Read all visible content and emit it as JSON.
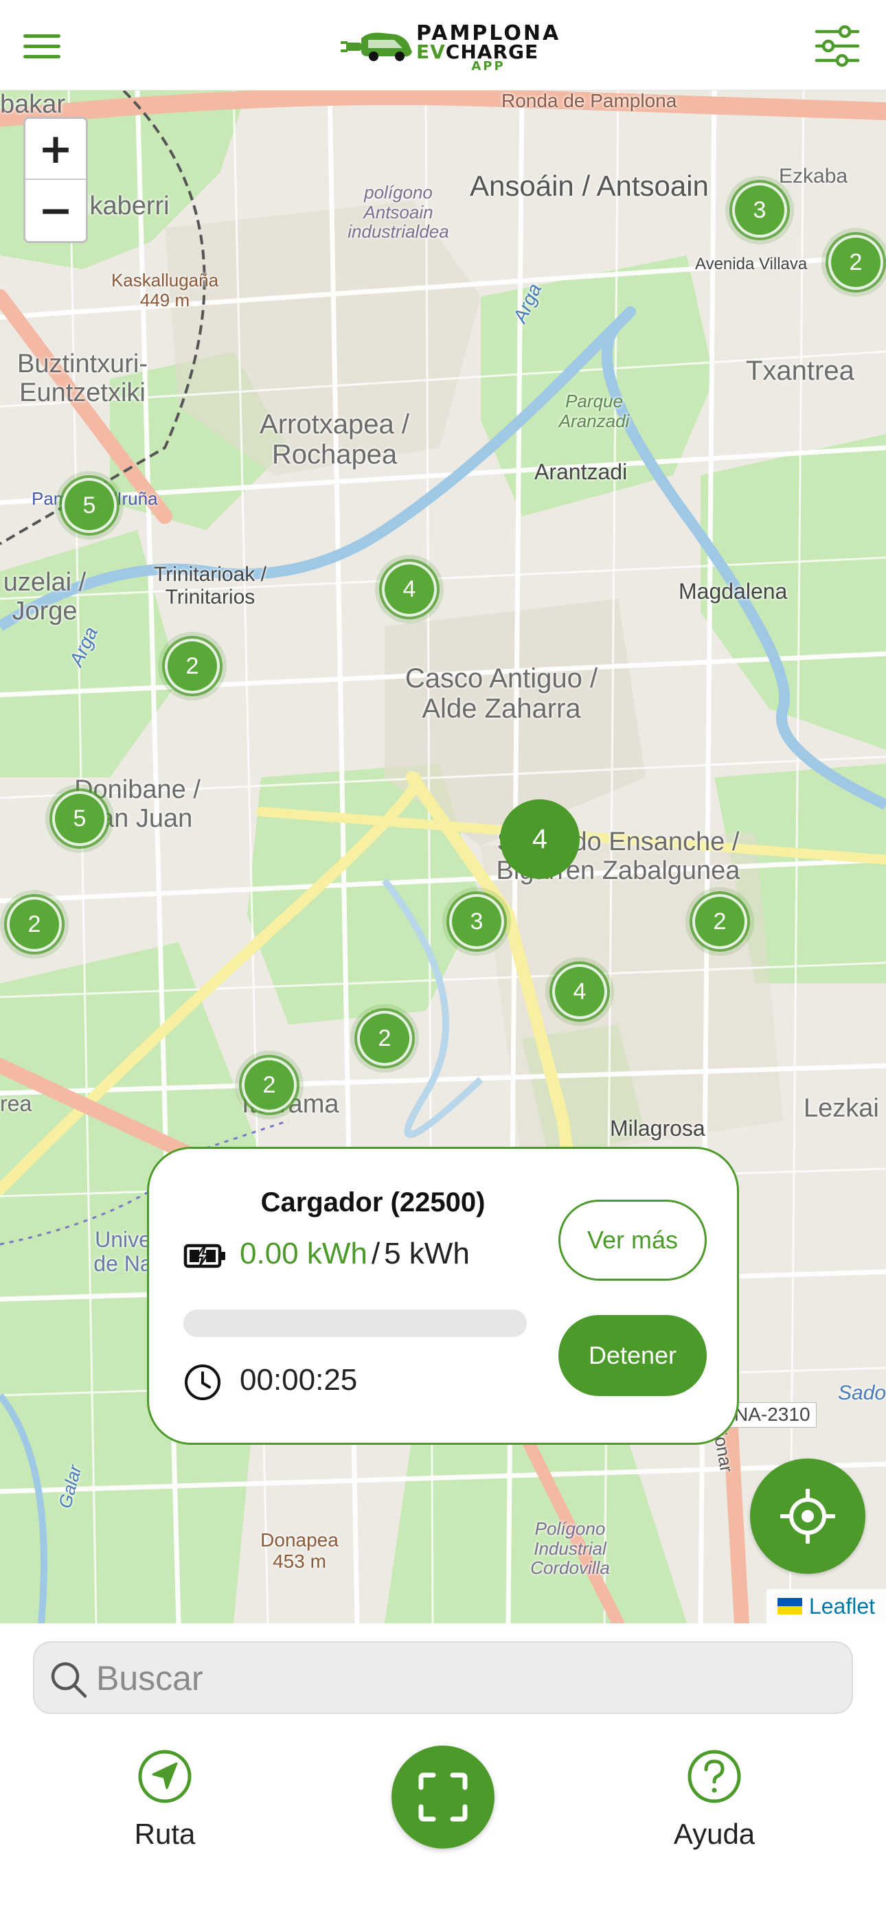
{
  "app": {
    "logo": {
      "line1": "PAMPLONA",
      "line2_ev": "EV",
      "line2_rest": "CHARGE",
      "line3": "APP"
    }
  },
  "header": {
    "menu_icon": "hamburger-icon",
    "filter_icon": "sliders-icon"
  },
  "map": {
    "zoom_in": "+",
    "zoom_out": "−",
    "labels": [
      {
        "text": "Ronda de Pamplona"
      },
      {
        "text": "bakar"
      },
      {
        "text": "Ansoáin / Antsoain"
      },
      {
        "text": "Ezkaba"
      },
      {
        "text": "Avenida Villava"
      },
      {
        "text": "polígono Antsoain industrialdea"
      },
      {
        "text": "ikaberri"
      },
      {
        "text": "Kaskallugaña 449 m"
      },
      {
        "text": "Buztintxuri-Euntzetxiki"
      },
      {
        "text": "Txantrea"
      },
      {
        "text": "Arrotxapea / Rochapea"
      },
      {
        "text": "Parque Aranzadi"
      },
      {
        "text": "Arantzadi"
      },
      {
        "text": "Pamplona/Iruña"
      },
      {
        "text": "Trinitarioak / Trinitarios"
      },
      {
        "text": "Magdalena"
      },
      {
        "text": "uzelai / Jorge"
      },
      {
        "text": "Casco Antiguo / Alde Zaharra"
      },
      {
        "text": "Donibane / San Juan"
      },
      {
        "text": "Segundo Ensanche / Bigarren Zabalgunea"
      },
      {
        "text": "Iturrama"
      },
      {
        "text": "Milagrosa"
      },
      {
        "text": "Lezkai"
      },
      {
        "text": "rea"
      },
      {
        "text": "Unive de Na"
      },
      {
        "text": "Calle Tajonar"
      },
      {
        "text": "NA-2310"
      },
      {
        "text": "Sado"
      },
      {
        "text": "Galar"
      },
      {
        "text": "Donapea 453 m"
      },
      {
        "text": "Polígono Industrial Cordovilla"
      },
      {
        "text": "Arga"
      },
      {
        "text": "Arga"
      }
    ],
    "clusters": [
      {
        "count": "3"
      },
      {
        "count": "2"
      },
      {
        "count": "5"
      },
      {
        "count": "4"
      },
      {
        "count": "2"
      },
      {
        "count": "5"
      },
      {
        "count": "4"
      },
      {
        "count": "2"
      },
      {
        "count": "3"
      },
      {
        "count": "2"
      },
      {
        "count": "4"
      },
      {
        "count": "2"
      },
      {
        "count": "2"
      }
    ],
    "attribution": "Leaflet",
    "locate_icon": "crosshair-icon"
  },
  "charging_card": {
    "title": "Cargador (22500)",
    "energy_current": "0.00 kWh",
    "energy_separator": "/",
    "energy_target": "5 kWh",
    "progress": 0,
    "elapsed": "00:00:25",
    "more_button": "Ver más",
    "stop_button": "Detener"
  },
  "search": {
    "placeholder": "Buscar"
  },
  "bottom_nav": {
    "route": {
      "label": "Ruta",
      "icon": "navigation-arrow-icon"
    },
    "scan": {
      "icon": "scan-qr-icon"
    },
    "help": {
      "label": "Ayuda",
      "icon": "help-circle-icon"
    }
  },
  "colors": {
    "accent": "#4c9a2a",
    "map_bg": "#eceae3",
    "park": "#c8e9b6",
    "road": "#ffffff",
    "main_road": "#f3c9b8",
    "river": "#9fc8e4"
  }
}
